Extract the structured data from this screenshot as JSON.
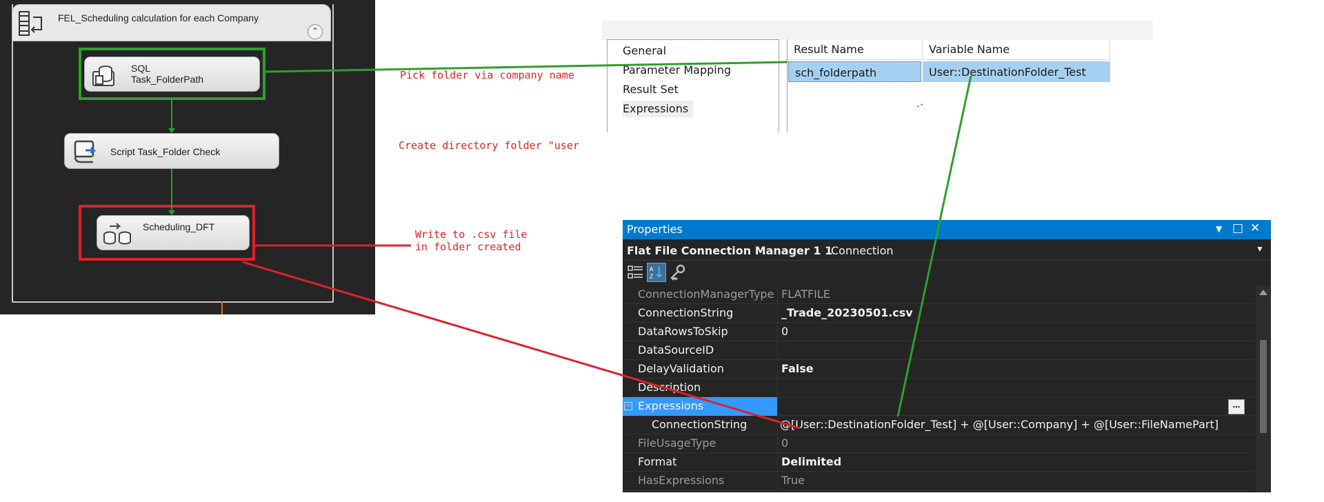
{
  "control_flow": {
    "container_title": "FEL_Scheduling calculation for each Company",
    "collapse_glyph": "⌃",
    "tasks": [
      {
        "label": "SQL Task_FolderPath",
        "icon": "database-icon"
      },
      {
        "label": "Script Task_Folder Check",
        "icon": "script-icon"
      },
      {
        "label": "Scheduling_DFT",
        "icon": "data-flow-icon"
      }
    ]
  },
  "result_set_dialog": {
    "nav_items": [
      "General",
      "Parameter Mapping",
      "Result Set",
      "Expressions"
    ],
    "active_nav": "Result Set",
    "columns": [
      "Result Name",
      "Variable Name"
    ],
    "rows": [
      {
        "result_name": "sch_folderpath",
        "variable_name": "User::DestinationFolder_Test"
      }
    ]
  },
  "annotations": {
    "pick_folder": "Pick folder via company name",
    "create_directory": "Create directory folder \"user",
    "write_csv": "Write to .csv file\nin folder created"
  },
  "properties_panel": {
    "title": "Properties",
    "object_name": "Flat File Connection Manager 1 1",
    "object_type": "Connection",
    "rows": [
      {
        "name": "ConnectionManagerType",
        "value": "FLATFILE"
      },
      {
        "name": "ConnectionString",
        "value": "_Trade_20230501.csv"
      },
      {
        "name": "DataRowsToSkip",
        "value": "0"
      },
      {
        "name": "DataSourceID",
        "value": ""
      },
      {
        "name": "DelayValidation",
        "value": "False"
      },
      {
        "name": "Description",
        "value": ""
      },
      {
        "name": "Expressions",
        "value": "",
        "button": "..."
      },
      {
        "name": "ConnectionString",
        "value": "@[User::DestinationFolder_Test]  + @[User::Company]  +  @[User::FileNamePart]"
      },
      {
        "name": "FileUsageType",
        "value": "0"
      },
      {
        "name": "Format",
        "value": "Delimited"
      },
      {
        "name": "HasExpressions",
        "value": "True"
      }
    ]
  },
  "colors": {
    "green_highlight": "#2ca02c",
    "red_highlight": "#e0202a",
    "properties_accent": "#007acc",
    "grid_selection": "#a6d0f2"
  }
}
